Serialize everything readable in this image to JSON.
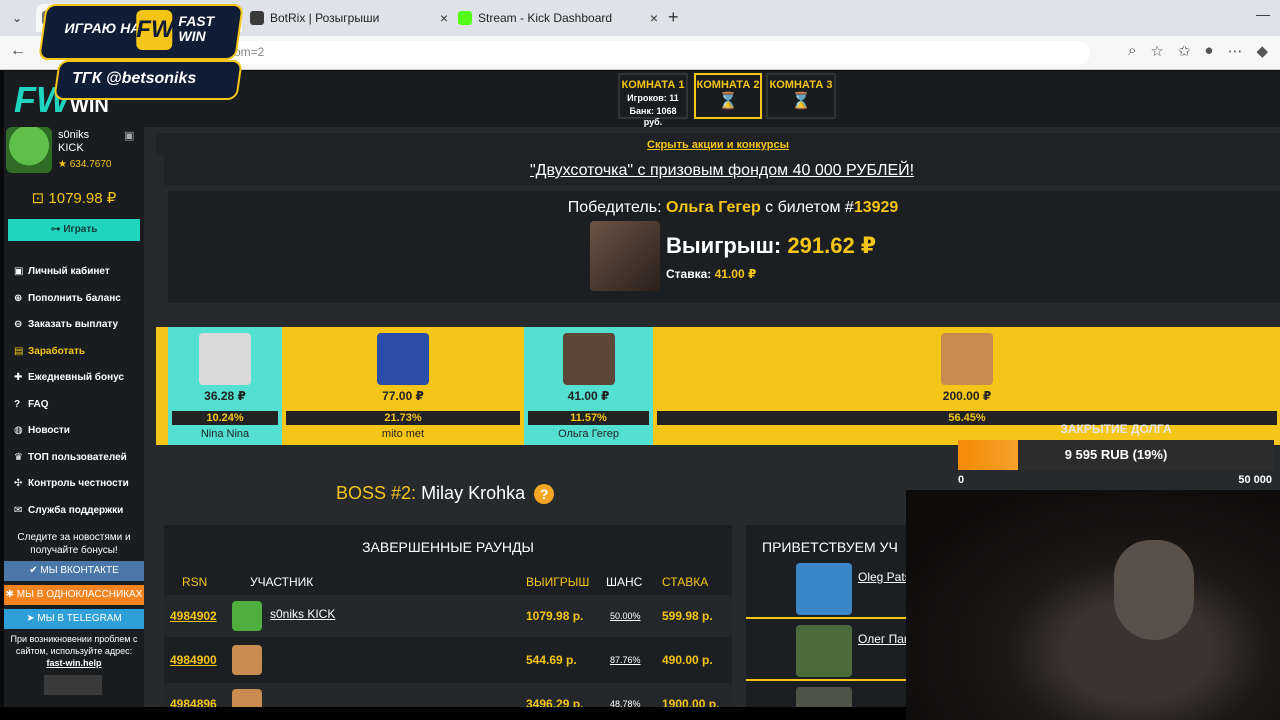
{
  "browser": {
    "tabs": [
      {
        "title": "",
        "icon_color": "#6c6c6c"
      },
      {
        "title": "BotRix | Розыгрыши",
        "icon_color": "#3a3a3a"
      },
      {
        "title": "Stream - Kick Dashboard",
        "icon_color": "#53fc18"
      }
    ],
    "url_tail": "om=2",
    "tab_list_icon": "chevron-down-icon",
    "new_tab_icon": "plus-icon"
  },
  "stream_overlay": {
    "brand_text": "ИГРАЮ НА",
    "brand_logo": "FW",
    "brand_name": "FAST WIN",
    "telegram_text": "ТГК @betsoniks",
    "debt": {
      "title": "ЗАКРЫТИЕ ДОЛГА",
      "progress_text": "9 595 RUB (19%)",
      "progress_fraction": 0.19,
      "min_label": "0",
      "max_label": "50 000",
      "fill_color": "#f58a07"
    }
  },
  "site": {
    "logo_mark": "FW",
    "logo_word": "WIN",
    "rooms": [
      {
        "name": "КОМНАТА 1",
        "players": "Игроков: 11",
        "bank": "Банк: 1068 руб.",
        "active": false
      },
      {
        "name": "КОМНАТА 2",
        "active": true
      },
      {
        "name": "КОМНАТА 3",
        "active": false
      }
    ],
    "user": {
      "name": "s0niks",
      "platform": "KICK",
      "points": "★ 634.7670",
      "balance": "⊡ 1079.98 ₽",
      "play_label": "⊶ Играть"
    },
    "menu": [
      {
        "icon": "briefcase-icon",
        "glyph": "▣",
        "label": "Личный кабинет"
      },
      {
        "icon": "plus-circle-icon",
        "glyph": "⊕",
        "label": "Пополнить баланс"
      },
      {
        "icon": "download-icon",
        "glyph": "⊖",
        "label": "Заказать выплату"
      },
      {
        "icon": "money-icon",
        "glyph": "▤",
        "label": "Заработать",
        "highlight": true
      },
      {
        "icon": "gift-icon",
        "glyph": "✚",
        "label": "Ежедневный бонус"
      },
      {
        "icon": "question-icon",
        "glyph": "?",
        "label": "FAQ"
      },
      {
        "icon": "globe-icon",
        "glyph": "◍",
        "label": "Новости"
      },
      {
        "icon": "trophy-icon",
        "glyph": "♛",
        "label": "ТОП пользователей"
      },
      {
        "icon": "shuffle-icon",
        "glyph": "✣",
        "label": "Контроль честности"
      },
      {
        "icon": "chat-icon",
        "glyph": "✉",
        "label": "Служба поддержки"
      }
    ],
    "news_hint": "Следите за новостями и получайте бонусы!",
    "socials": [
      {
        "label": "МЫ ВКОНТАКТЕ",
        "color": "#4a76a8"
      },
      {
        "label": "МЫ В ОДНОКЛАССНИКАХ",
        "color": "#f48420"
      },
      {
        "label": "МЫ В TELEGRAM",
        "color": "#2e9fd8"
      }
    ],
    "support_hint": "При возникновении проблем с сайтом, используйте адрес:",
    "support_domain": "fast-win.help",
    "promo": {
      "hide_label": "Скрыть акции и конкурсы",
      "title": "\"Двухсоточка\" с призовым фондом 40 000 РУБЛЕЙ!"
    },
    "winner": {
      "prefix": "Победитель:",
      "name": "Ольга Гегер",
      "ticket_prefix": "с билетом #",
      "ticket": "13929",
      "win_label": "Выигрыш:",
      "win_amount": "291.62 ₽",
      "bet_label": "Ставка:",
      "bet_amount": "41.00 ₽"
    },
    "participants": [
      {
        "amount": "36.28 ₽",
        "percent": "10.24%",
        "name": "Nina Nina",
        "share": 0.1024,
        "style": "teal",
        "photo_color": "#d9d9d9"
      },
      {
        "amount": "77.00 ₽",
        "percent": "21.73%",
        "name": "mito met",
        "share": 0.2173,
        "style": "yellow",
        "photo_color": "#2a4ea8"
      },
      {
        "amount": "41.00 ₽",
        "percent": "11.57%",
        "name": "Ольга Гегер",
        "share": 0.1157,
        "style": "teal",
        "photo_color": "#5c4638"
      },
      {
        "amount": "200.00 ₽",
        "percent": "56.45%",
        "name": "",
        "share": 0.5645,
        "style": "yellow",
        "photo_color": "#c98b4f"
      }
    ],
    "boss": {
      "label": "BOSS #2:",
      "name": "Milay Krohka"
    },
    "rounds": {
      "title": "ЗАВЕРШЕННЫЕ РАУНДЫ",
      "headers": {
        "rsn": "RSN",
        "user": "УЧАСТНИК",
        "win": "ВЫИГРЫШ",
        "chance": "ШАНС",
        "bet": "СТАВКА"
      },
      "rows": [
        {
          "rsn": "4984902",
          "user": "s0niks KICK",
          "win": "1079.98 р.",
          "chance": "50.00%",
          "bet": "599.98 р.",
          "avatar_color": "#4fae3d"
        },
        {
          "rsn": "4984900",
          "user": "",
          "win": "544.69 р.",
          "chance": "87.76%",
          "bet": "490.00 р.",
          "avatar_color": "#c98b4f"
        },
        {
          "rsn": "4984896",
          "user": "",
          "win": "3496.29 р.",
          "chance": "48.78%",
          "bet": "1900.00 р.",
          "avatar_color": "#c98b4f"
        }
      ]
    },
    "welcome": {
      "title": "ПРИВЕТСТВУЕМ УЧ",
      "guests": [
        {
          "name": "Oleg Patsuke",
          "photo_color": "#3b86c7"
        },
        {
          "name": "Олег Пацуке",
          "photo_color": "#4d6a3a"
        },
        {
          "name": "",
          "photo_color": "#4f5448"
        }
      ]
    }
  }
}
